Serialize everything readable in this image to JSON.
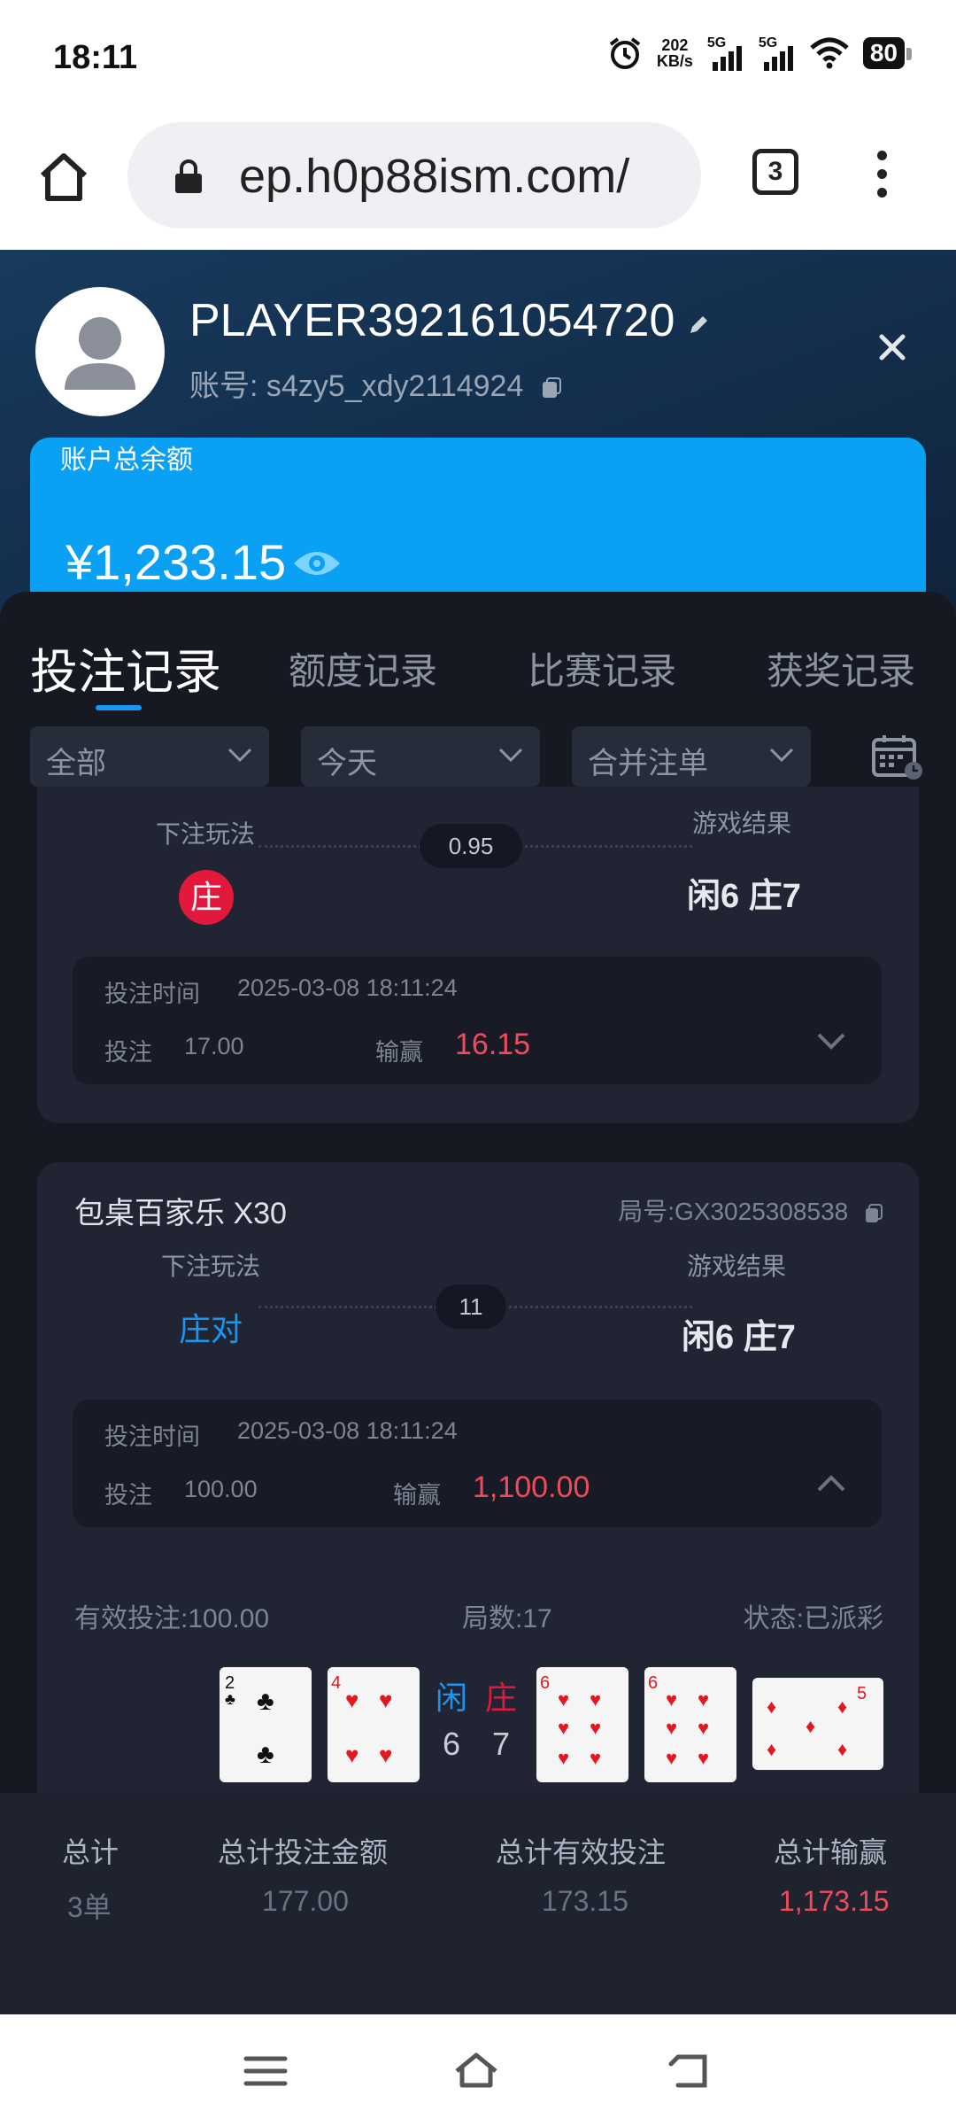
{
  "status_bar": {
    "time": "18:11",
    "net_speed_value": "202",
    "net_speed_unit": "KB/s",
    "signal1": "5G",
    "signal2": "5G",
    "battery": "80",
    "icons": [
      "alarm-icon",
      "signal-icon",
      "wifi-icon",
      "battery-icon"
    ]
  },
  "browser": {
    "url": "ep.h0p88ism.com/",
    "tab_count": "3",
    "icons": [
      "home-icon",
      "lock-icon",
      "tabs-icon",
      "menu-icon"
    ]
  },
  "profile": {
    "username": "PLAYER392161054720",
    "account": "账号: s4zy5_xdy2114924"
  },
  "balance": {
    "label": "账户总余额",
    "amount": "¥1,233.15"
  },
  "tabs": [
    {
      "label": "投注记录",
      "active": true
    },
    {
      "label": "额度记录",
      "active": false
    },
    {
      "label": "比赛记录",
      "active": false
    },
    {
      "label": "获奖记录",
      "active": false
    }
  ],
  "filters": [
    {
      "value": "全部"
    },
    {
      "value": "今天"
    },
    {
      "value": "合并注单"
    }
  ],
  "records": [
    {
      "bet_type_label": "下注玩法",
      "bet_choice": "庄",
      "odds": "0.95",
      "result_label": "游戏结果",
      "result": "闲6 庄7",
      "time_label": "投注时间",
      "time": "2025-03-08 18:11:24",
      "stake_label": "投注",
      "stake": "17.00",
      "winloss_label": "输赢",
      "winloss": "16.15"
    },
    {
      "game": "包桌百家乐 X30",
      "round": "局号:GX3025308538",
      "bet_type_label": "下注玩法",
      "bet_choice": "庄对",
      "odds": "11",
      "result_label": "游戏结果",
      "result": "闲6 庄7",
      "time_label": "投注时间",
      "time": "2025-03-08 18:11:24",
      "stake_label": "投注",
      "stake": "100.00",
      "winloss_label": "输赢",
      "winloss": "1,100.00",
      "valid_bet": "有效投注:100.00",
      "rounds": "局数:17",
      "status": "状态:已派彩",
      "player_label": "闲",
      "banker_label": "庄",
      "player_total": "6",
      "banker_total": "7",
      "cards": [
        {
          "rank": "2",
          "suit": "♣",
          "color": "#111111"
        },
        {
          "rank": "4",
          "suit": "♥",
          "color": "#e3171f"
        },
        {
          "rank": "6",
          "suit": "♥",
          "color": "#e3171f"
        },
        {
          "rank": "6",
          "suit": "♥",
          "color": "#e3171f"
        },
        {
          "rank": "5",
          "suit": "♦",
          "color": "#e3171f"
        }
      ]
    }
  ],
  "totals": {
    "headers": [
      "总计",
      "总计投注金额",
      "总计有效投注",
      "总计输赢"
    ],
    "values": [
      "3单",
      "177.00",
      "173.15",
      "1,173.15"
    ]
  },
  "colors": {
    "accent": "#1b95f3",
    "balance_card": "#0aa0f4",
    "win_red": "#f04b5a",
    "banker_red": "#e2183c"
  }
}
